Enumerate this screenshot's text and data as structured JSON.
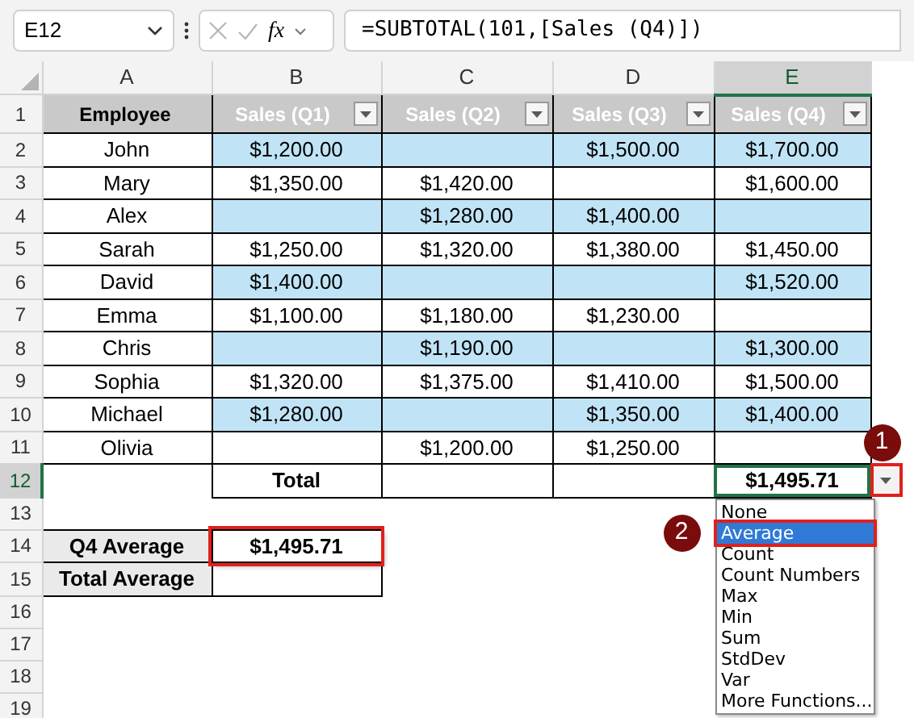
{
  "name_box": "E12",
  "fx": "fx",
  "formula": "=SUBTOTAL(101,[Sales (Q4)])",
  "columns": [
    {
      "label": "A",
      "selected": false
    },
    {
      "label": "B",
      "selected": false
    },
    {
      "label": "C",
      "selected": false
    },
    {
      "label": "D",
      "selected": false
    },
    {
      "label": "E",
      "selected": true
    }
  ],
  "rows": [
    {
      "number": "1",
      "selected": false,
      "kind": "header",
      "cells": [
        {
          "text": "Employee",
          "filter": false
        },
        {
          "text": "Sales (Q1)",
          "filter": true
        },
        {
          "text": "Sales (Q2)",
          "filter": true
        },
        {
          "text": "Sales (Q3)",
          "filter": true
        },
        {
          "text": "Sales (Q4)",
          "filter": true
        }
      ]
    },
    {
      "number": "2",
      "selected": false,
      "kind": "data",
      "band": true,
      "cells": [
        "John",
        "$1,200.00",
        "",
        "$1,500.00",
        "$1,700.00"
      ]
    },
    {
      "number": "3",
      "selected": false,
      "kind": "data",
      "band": false,
      "cells": [
        "Mary",
        "$1,350.00",
        "$1,420.00",
        "",
        "$1,600.00"
      ]
    },
    {
      "number": "4",
      "selected": false,
      "kind": "data",
      "band": true,
      "cells": [
        "Alex",
        "",
        "$1,280.00",
        "$1,400.00",
        ""
      ]
    },
    {
      "number": "5",
      "selected": false,
      "kind": "data",
      "band": false,
      "cells": [
        "Sarah",
        "$1,250.00",
        "$1,320.00",
        "$1,380.00",
        "$1,450.00"
      ]
    },
    {
      "number": "6",
      "selected": false,
      "kind": "data",
      "band": true,
      "cells": [
        "David",
        "$1,400.00",
        "",
        "",
        "$1,520.00"
      ]
    },
    {
      "number": "7",
      "selected": false,
      "kind": "data",
      "band": false,
      "cells": [
        "Emma",
        "$1,100.00",
        "$1,180.00",
        "$1,230.00",
        ""
      ]
    },
    {
      "number": "8",
      "selected": false,
      "kind": "data",
      "band": true,
      "cells": [
        "Chris",
        "",
        "$1,190.00",
        "",
        "$1,300.00"
      ]
    },
    {
      "number": "9",
      "selected": false,
      "kind": "data",
      "band": false,
      "cells": [
        "Sophia",
        "$1,320.00",
        "$1,375.00",
        "$1,410.00",
        "$1,500.00"
      ]
    },
    {
      "number": "10",
      "selected": false,
      "kind": "data",
      "band": true,
      "cells": [
        "Michael",
        "$1,280.00",
        "",
        "$1,350.00",
        "$1,400.00"
      ]
    },
    {
      "number": "11",
      "selected": false,
      "kind": "data",
      "band": false,
      "cells": [
        "Olivia",
        "",
        "$1,200.00",
        "$1,250.00",
        ""
      ]
    },
    {
      "number": "12",
      "selected": true,
      "kind": "total",
      "cells": [
        "",
        "Total",
        "",
        "",
        "$1,495.71"
      ],
      "dropdown_highlighted": true
    },
    {
      "number": "13",
      "selected": false,
      "kind": "empty"
    },
    {
      "number": "14",
      "selected": false,
      "kind": "summary",
      "label": "Q4 Average",
      "value": "$1,495.71",
      "highlighted": true
    },
    {
      "number": "15",
      "selected": false,
      "kind": "summary",
      "label": "Total Average",
      "value": "",
      "highlighted": false
    },
    {
      "number": "16",
      "selected": false,
      "kind": "empty"
    },
    {
      "number": "17",
      "selected": false,
      "kind": "empty"
    },
    {
      "number": "18",
      "selected": false,
      "kind": "empty"
    },
    {
      "number": "19",
      "selected": false,
      "kind": "empty"
    }
  ],
  "dropdown": {
    "items": [
      {
        "label": "None",
        "selected": false,
        "highlighted": false
      },
      {
        "label": "Average",
        "selected": true,
        "highlighted": true
      },
      {
        "label": "Count",
        "selected": false,
        "highlighted": false
      },
      {
        "label": "Count Numbers",
        "selected": false,
        "highlighted": false
      },
      {
        "label": "Max",
        "selected": false,
        "highlighted": false
      },
      {
        "label": "Min",
        "selected": false,
        "highlighted": false
      },
      {
        "label": "Sum",
        "selected": false,
        "highlighted": false
      },
      {
        "label": "StdDev",
        "selected": false,
        "highlighted": false
      },
      {
        "label": "Var",
        "selected": false,
        "highlighted": false
      },
      {
        "label": "More Functions...",
        "selected": false,
        "highlighted": false
      }
    ]
  },
  "callouts": [
    "1",
    "2"
  ]
}
